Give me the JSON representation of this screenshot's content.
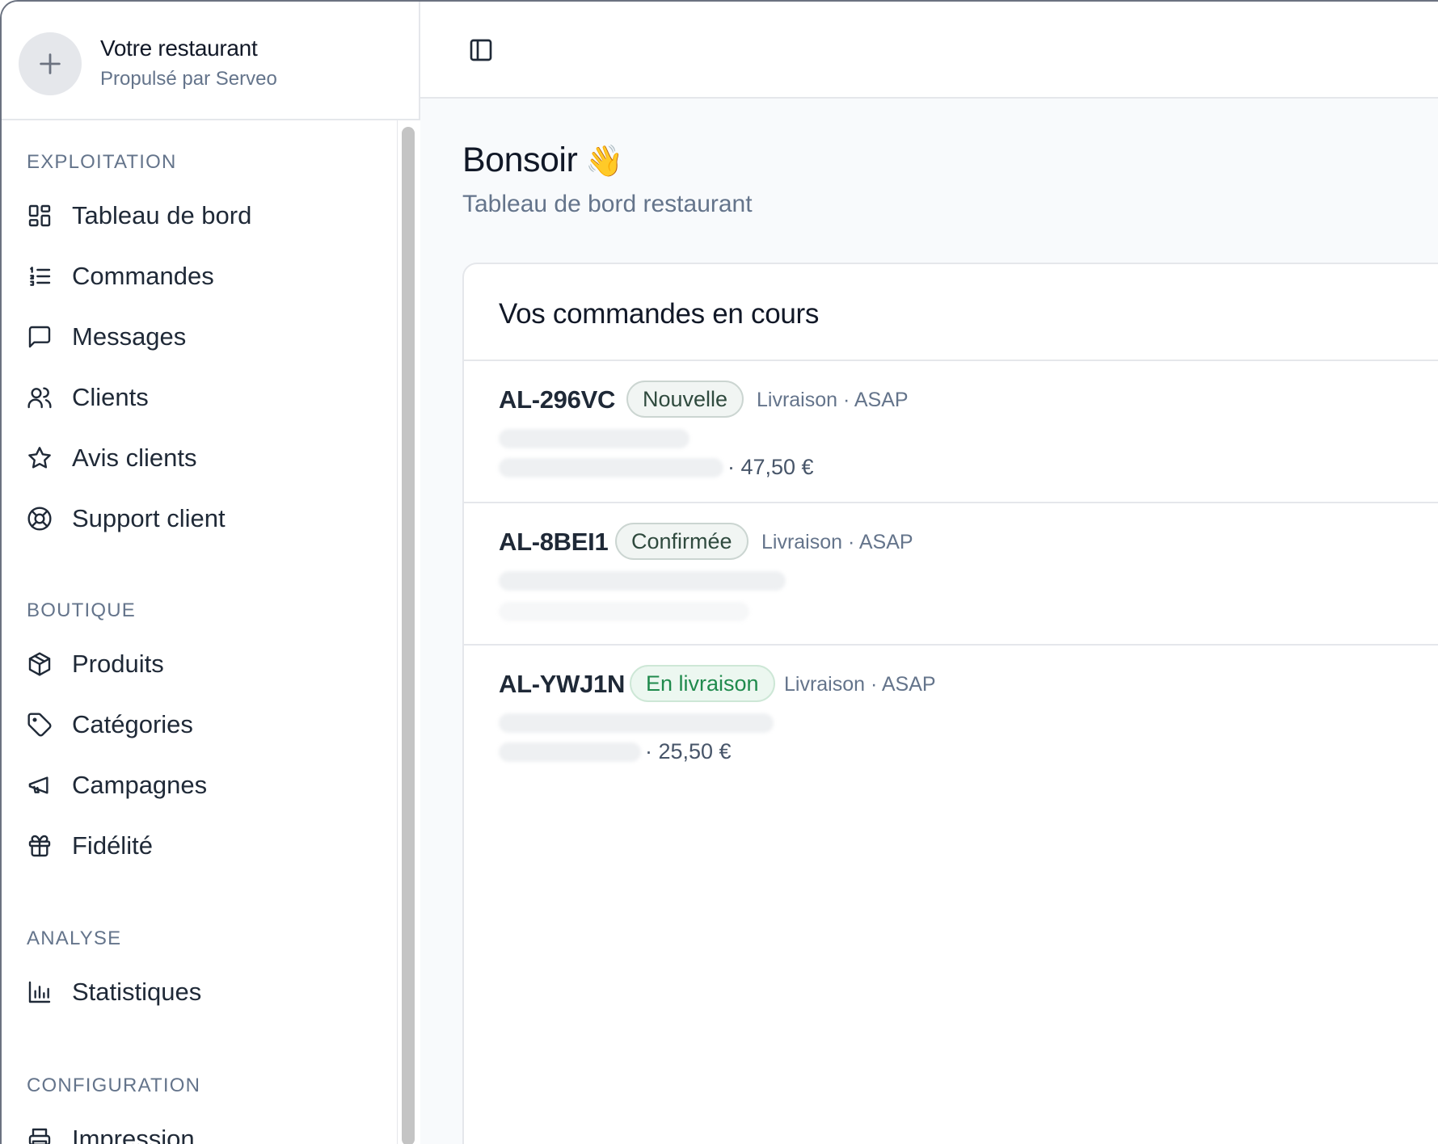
{
  "brand": {
    "name": "Votre restaurant",
    "tagline": "Propulsé par Serveo"
  },
  "sidebar": {
    "sections": [
      {
        "title": "EXPLOITATION",
        "items": [
          {
            "label": "Tableau de bord",
            "icon": "dashboard-grid-icon"
          },
          {
            "label": "Commandes",
            "icon": "list-ordered-icon"
          },
          {
            "label": "Messages",
            "icon": "chat-bubble-icon"
          },
          {
            "label": "Clients",
            "icon": "users-icon"
          },
          {
            "label": "Avis clients",
            "icon": "star-icon"
          },
          {
            "label": "Support client",
            "icon": "lifebuoy-icon"
          }
        ]
      },
      {
        "title": "BOUTIQUE",
        "items": [
          {
            "label": "Produits",
            "icon": "package-icon"
          },
          {
            "label": "Catégories",
            "icon": "tag-icon"
          },
          {
            "label": "Campagnes",
            "icon": "megaphone-icon"
          },
          {
            "label": "Fidélité",
            "icon": "gift-icon"
          }
        ]
      },
      {
        "title": "ANALYSE",
        "items": [
          {
            "label": "Statistiques",
            "icon": "bar-chart-icon"
          }
        ]
      },
      {
        "title": "CONFIGURATION",
        "items": [
          {
            "label": "Impression",
            "icon": "printer-icon"
          }
        ]
      }
    ]
  },
  "header": {
    "toggle_icon": "sidebar-toggle-icon"
  },
  "main": {
    "greeting": "Bonsoir",
    "greeting_emoji": "👋",
    "subtitle": "Tableau de bord restaurant",
    "orders_card": {
      "title": "Vos commandes en cours",
      "orders": [
        {
          "id": "AL-296VC",
          "status": "Nouvelle",
          "status_type": "new",
          "meta": "Livraison · ASAP",
          "price": "· 47,50 €"
        },
        {
          "id": "AL-8BEI1",
          "status": "Confirmée",
          "status_type": "confirmed",
          "meta": "Livraison · ASAP",
          "price": ""
        },
        {
          "id": "AL-YWJ1N",
          "status": "En livraison",
          "status_type": "delivering",
          "meta": "Livraison · ASAP",
          "price": "· 25,50 €"
        }
      ]
    }
  }
}
